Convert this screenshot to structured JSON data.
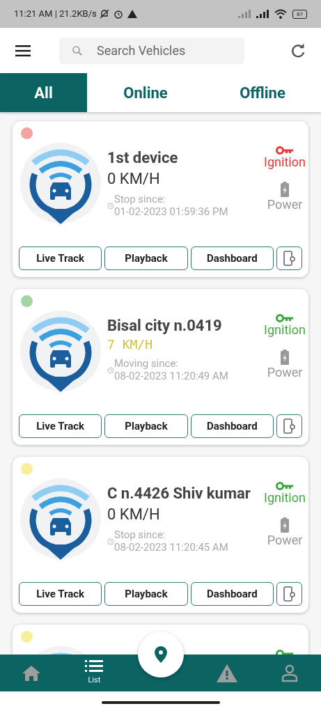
{
  "status_bar": {
    "time": "11:21 AM | 21.2KB/s",
    "battery": "87"
  },
  "search": {
    "placeholder": "Search Vehicles"
  },
  "tabs": [
    {
      "label": "All",
      "selected": true
    },
    {
      "label": "Online",
      "selected": false
    },
    {
      "label": "Offline",
      "selected": false
    }
  ],
  "vehicles": [
    {
      "color": "#f4a3a3",
      "name": "1st device",
      "speed": "0 KM/H",
      "moving": false,
      "since_label": "Stop since:",
      "since": "01-02-2023 01:59:36 PM",
      "ignition_on": false,
      "ignition": "Ignition",
      "power": "Power",
      "actions": [
        "Live Track",
        "Playback",
        "Dashboard"
      ]
    },
    {
      "color": "#a3d4a3",
      "name": "Bisal city n.0419",
      "speed": "7 KM/H",
      "moving": true,
      "since_label": "Moving since:",
      "since": "08-02-2023 11:20:49 AM",
      "ignition_on": true,
      "ignition": "Ignition",
      "power": "Power",
      "actions": [
        "Live Track",
        "Playback",
        "Dashboard"
      ]
    },
    {
      "color": "#f8ef9a",
      "name": "C n.4426 Shiv kumar",
      "speed": "0 KM/H",
      "moving": false,
      "since_label": "Stop since:",
      "since": "08-02-2023 11:20:45 AM",
      "ignition_on": true,
      "ignition": "Ignition",
      "power": "Power",
      "actions": [
        "Live Track",
        "Playback",
        "Dashboard"
      ]
    },
    {
      "color": "#f8ef9a",
      "ignition_on": true
    }
  ],
  "bottom_nav": [
    {
      "kind": "home",
      "selected": false
    },
    {
      "kind": "list",
      "label": "List",
      "selected": true
    },
    {
      "kind": "alert",
      "selected": false
    },
    {
      "kind": "profile",
      "selected": false
    }
  ]
}
